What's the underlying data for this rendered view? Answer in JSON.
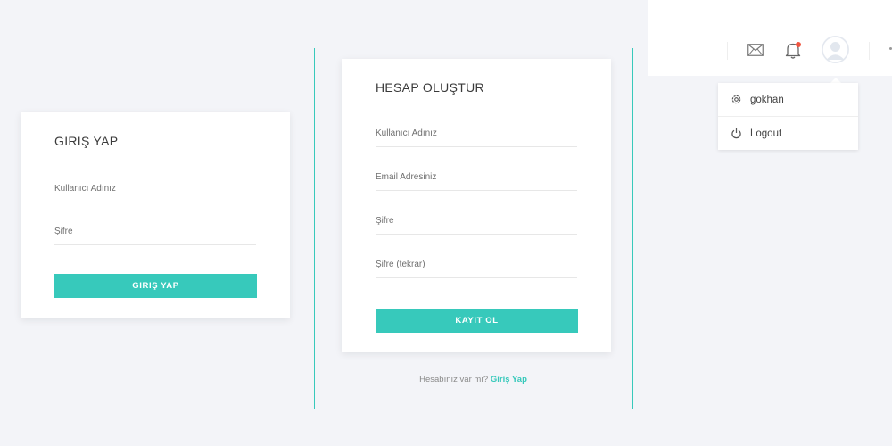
{
  "login": {
    "title": "GIRIŞ YAP",
    "username_placeholder": "Kullanıcı Adınız",
    "password_placeholder": "Şifre",
    "button_label": "GIRIŞ YAP"
  },
  "register": {
    "title": "HESAP OLUŞTUR",
    "username_placeholder": "Kullanıcı Adınız",
    "email_placeholder": "Email Adresiniz",
    "password_placeholder": "Şifre",
    "password_repeat_placeholder": "Şifre (tekrar)",
    "button_label": "KAYIT OL",
    "footer_text": "Hesabınız var mı?",
    "footer_link": "Giriş Yap"
  },
  "topbar": {
    "icons": [
      "mail-icon",
      "bell-icon",
      "avatar"
    ],
    "notification_dot_color": "#f0543f"
  },
  "user_menu": {
    "items": [
      {
        "label": "gokhan",
        "icon": "gear-icon"
      },
      {
        "label": "Logout",
        "icon": "power-icon"
      }
    ]
  },
  "colors": {
    "accent": "#37c9bb",
    "background": "#f3f4f8"
  }
}
